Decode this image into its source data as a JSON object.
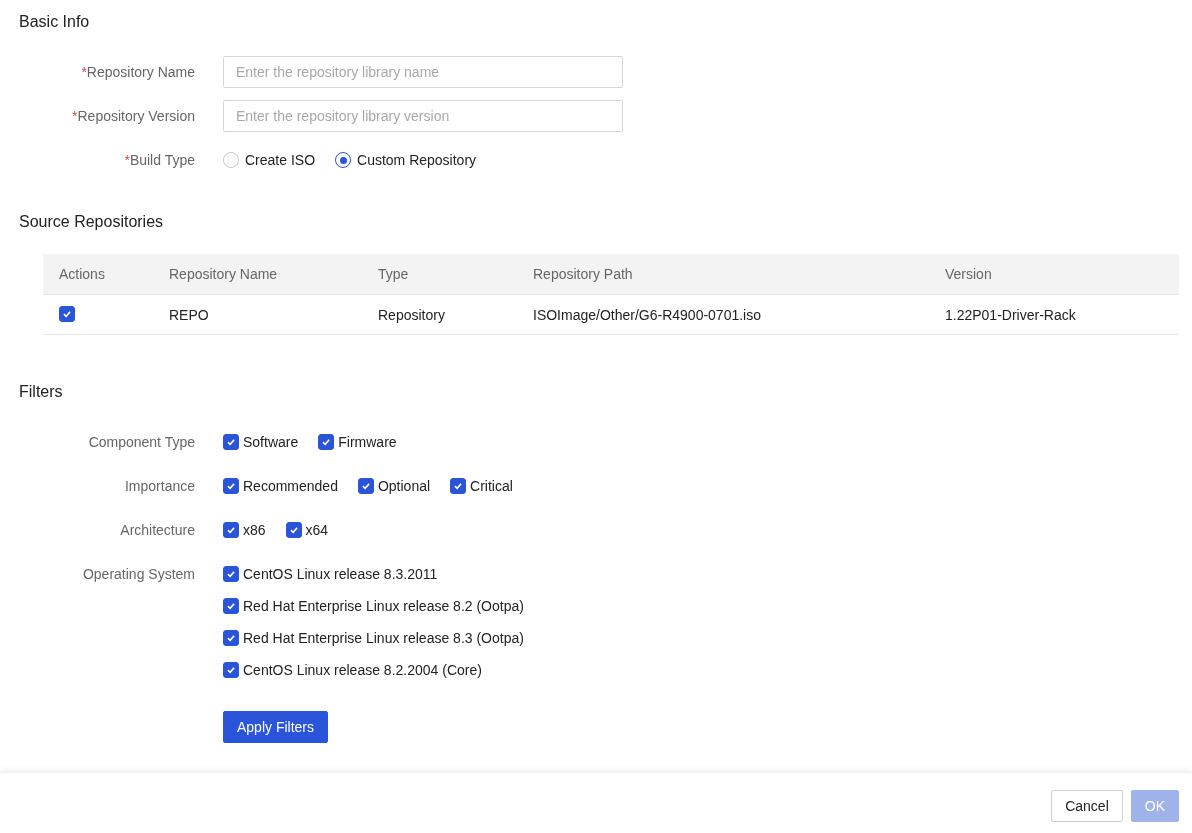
{
  "basic_info": {
    "title": "Basic Info",
    "fields": [
      {
        "kind": "text",
        "required_mark": "*",
        "label": "Repository Name",
        "placeholder": "Enter the repository library name"
      },
      {
        "kind": "text",
        "required_mark": "*",
        "label": "Repository Version",
        "placeholder": "Enter the repository library version"
      },
      {
        "kind": "radio",
        "required_mark": "*",
        "label": "Build Type",
        "options": [
          {
            "label": "Create ISO",
            "selected": false
          },
          {
            "label": "Custom Repository",
            "selected": true
          }
        ]
      }
    ]
  },
  "source_repositories": {
    "title": "Source Repositories",
    "columns": [
      "Actions",
      "Repository Name",
      "Type",
      "Repository Path",
      "Version"
    ],
    "rows": [
      {
        "checked": true,
        "cells": [
          "",
          "REPO",
          "Repository",
          "ISOImage/Other/G6-R4900-0701.iso",
          "1.22P01-Driver-Rack"
        ]
      }
    ]
  },
  "filters": {
    "title": "Filters",
    "groups": [
      {
        "kind": "inline",
        "label": "Component Type",
        "options": [
          {
            "label": "Software",
            "checked": true
          },
          {
            "label": "Firmware",
            "checked": true
          }
        ]
      },
      {
        "kind": "inline",
        "label": "Importance",
        "options": [
          {
            "label": "Recommended",
            "checked": true
          },
          {
            "label": "Optional",
            "checked": true
          },
          {
            "label": "Critical",
            "checked": true
          }
        ]
      },
      {
        "kind": "inline",
        "label": "Architecture",
        "options": [
          {
            "label": "x86",
            "checked": true
          },
          {
            "label": "x64",
            "checked": true
          }
        ]
      },
      {
        "kind": "stacked",
        "label": "Operating System",
        "options": [
          {
            "label": "CentOS Linux release 8.3.2011",
            "checked": true
          },
          {
            "label": "Red Hat Enterprise Linux release 8.2 (Ootpa)",
            "checked": true
          },
          {
            "label": "Red Hat Enterprise Linux release 8.3 (Ootpa)",
            "checked": true
          },
          {
            "label": "CentOS Linux release 8.2.2004 (Core)",
            "checked": true
          }
        ]
      }
    ],
    "apply_button": "Apply Filters"
  },
  "footer": {
    "buttons": [
      {
        "kind": "default",
        "label": "Cancel"
      },
      {
        "kind": "primary",
        "label": "OK",
        "disabled": true
      }
    ]
  }
}
